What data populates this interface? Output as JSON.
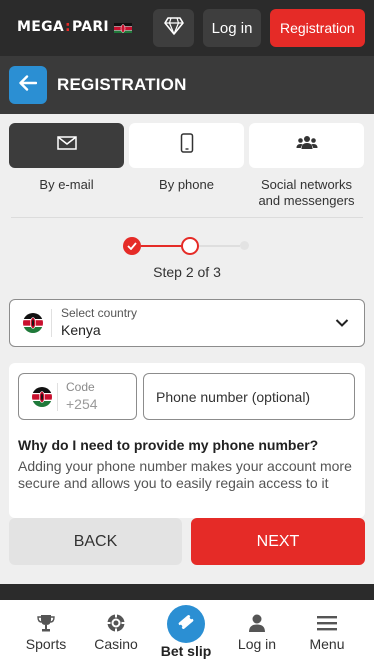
{
  "header": {
    "logo_part1": "MEGA",
    "logo_colon": ":",
    "logo_part2": "PARI",
    "login_label": "Log in",
    "register_label": "Registration"
  },
  "registration": {
    "title": "REGISTRATION"
  },
  "tabs": [
    {
      "label": "By e-mail",
      "icon": "envelope-icon",
      "active": true
    },
    {
      "label": "By phone",
      "icon": "phone-icon",
      "active": false
    },
    {
      "label": "Social networks and messengers",
      "icon": "people-icon",
      "active": false
    }
  ],
  "stepper": {
    "text": "Step 2 of 3",
    "current": 2,
    "total": 3
  },
  "country": {
    "caption": "Select country",
    "value": "Kenya"
  },
  "phone": {
    "code_caption": "Code",
    "code_value": "+254",
    "number_placeholder": "Phone number (optional)",
    "why_title": "Why do I need to provide my phone number?",
    "why_text": "Adding your phone number makes your account more secure and allows you to easily regain access to it"
  },
  "actions": {
    "back_label": "BACK",
    "next_label": "NEXT"
  },
  "bottom_nav": {
    "sports": "Sports",
    "casino": "Casino",
    "bet_slip": "Bet slip",
    "login": "Log in",
    "menu": "Menu"
  },
  "colors": {
    "accent_red": "#e52b27",
    "accent_blue": "#2b8fd3",
    "dark_bg": "#2b2b2b"
  }
}
